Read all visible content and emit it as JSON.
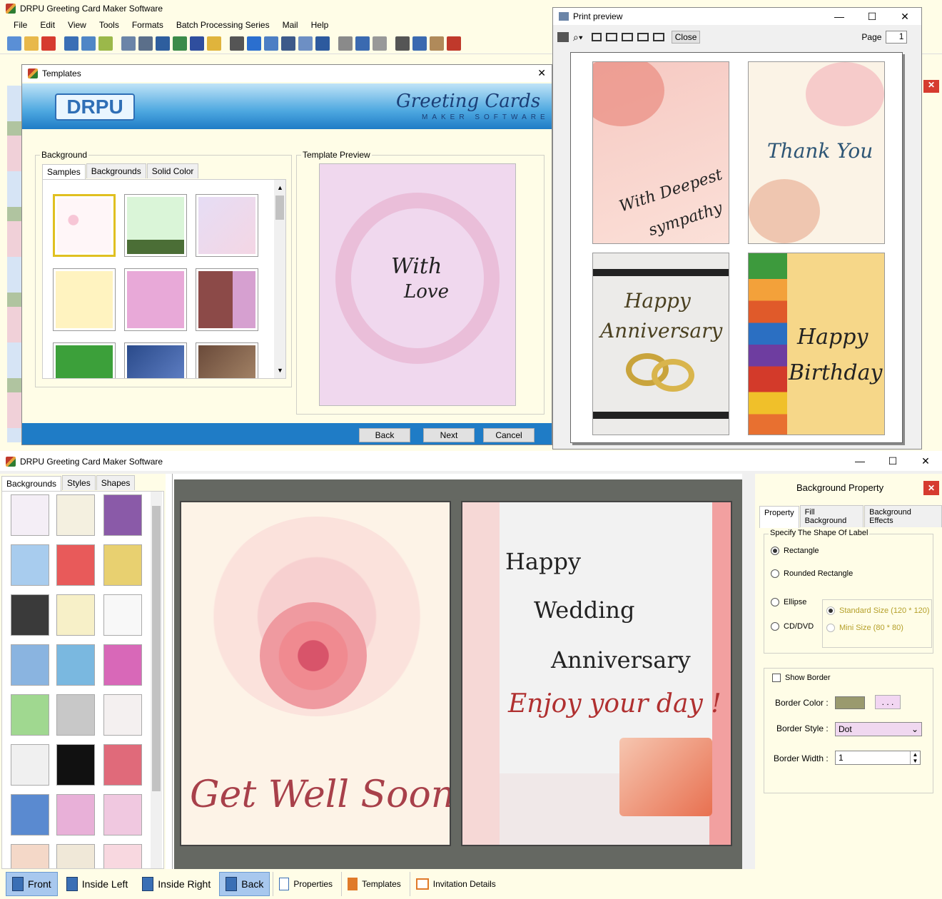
{
  "main_window": {
    "title": "DRPU Greeting Card Maker Software",
    "menu": [
      "File",
      "Edit",
      "View",
      "Tools",
      "Formats",
      "Batch Processing Series",
      "Mail",
      "Help"
    ]
  },
  "templates_dialog": {
    "title": "Templates",
    "banner_logo": "DRPU",
    "banner_title": "Greeting Cards",
    "banner_subtitle": "MAKER SOFTWARE",
    "background_label": "Background",
    "tabs": [
      "Samples",
      "Backgrounds",
      "Solid Color"
    ],
    "preview_label": "Template Preview",
    "preview_text_1": "With",
    "preview_text_2": "Love",
    "buttons": {
      "back": "Back",
      "next": "Next",
      "cancel": "Cancel"
    }
  },
  "print_preview": {
    "title": "Print preview",
    "close_label": "Close",
    "page_label": "Page",
    "page_value": "1",
    "cards": [
      {
        "line1": "With Deepest",
        "line2": "sympathy"
      },
      {
        "line1": "Thank You",
        "line2": ""
      },
      {
        "line1": "Happy",
        "line2": "Anniversary"
      },
      {
        "line1": "Happy",
        "line2": "Birthday"
      }
    ]
  },
  "editor": {
    "title": "DRPU Greeting Card Maker Software",
    "left_tabs": [
      "Backgrounds",
      "Styles",
      "Shapes"
    ],
    "card_left_text": "Get Well Soon",
    "card_right": {
      "line1": "Happy",
      "line2": "Wedding",
      "line3": "Anniversary",
      "line4": "Enjoy your day !"
    },
    "bottom_tabs": [
      "Front",
      "Inside Left",
      "Inside Right",
      "Back",
      "Properties",
      "Templates",
      "Invitation Details"
    ]
  },
  "bg_property": {
    "title": "Background Property",
    "tabs": [
      "Property",
      "Fill Background",
      "Background Effects"
    ],
    "shape_label": "Specify The Shape Of Label",
    "shapes": [
      "Rectangle",
      "Rounded Rectangle",
      "Ellipse",
      "CD/DVD"
    ],
    "size_options": [
      "Standard Size (120 * 120)",
      "Mini Size (80 * 80)"
    ],
    "show_border": "Show Border",
    "border_color_label": "Border Color :",
    "border_color_btn": ". . .",
    "border_style_label": "Border Style :",
    "border_style_value": "Dot",
    "border_width_label": "Border Width :",
    "border_width_value": "1",
    "border_color": "#9a9a6e"
  }
}
